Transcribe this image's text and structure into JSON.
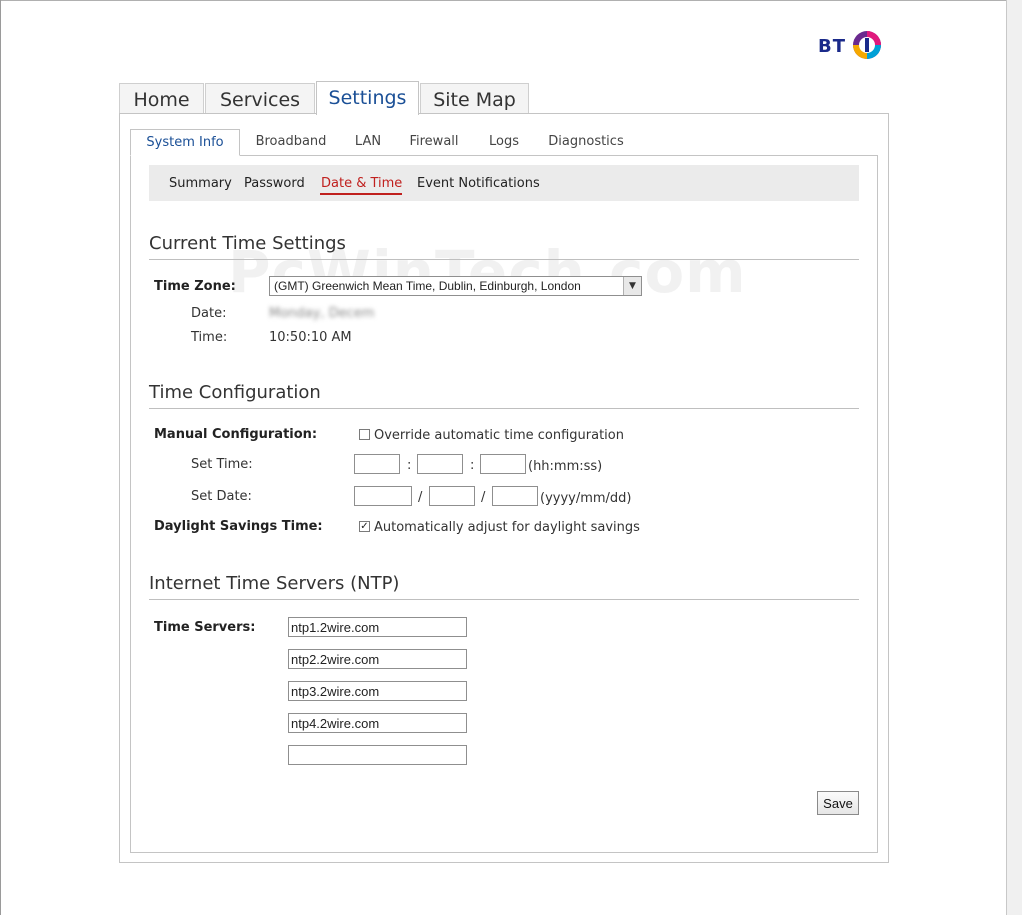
{
  "brand": {
    "logo_text": "BT"
  },
  "main_tabs": [
    {
      "label": "Home"
    },
    {
      "label": "Services"
    },
    {
      "label": "Settings"
    },
    {
      "label": "Site Map"
    }
  ],
  "sub_tabs": [
    {
      "label": "System Info"
    },
    {
      "label": "Broadband"
    },
    {
      "label": "LAN"
    },
    {
      "label": "Firewall"
    },
    {
      "label": "Logs"
    },
    {
      "label": "Diagnostics"
    }
  ],
  "subnav": [
    {
      "label": "Summary"
    },
    {
      "label": "Password"
    },
    {
      "label": "Date & Time"
    },
    {
      "label": "Event Notifications"
    }
  ],
  "watermark": "PcWinTech.com",
  "current_time": {
    "title": "Current Time Settings",
    "timezone_label": "Time Zone:",
    "timezone_value": "(GMT) Greenwich Mean Time, Dublin, Edinburgh, London",
    "date_label": "Date:",
    "date_value": "Monday, Decem",
    "time_label": "Time:",
    "time_value": "10:50:10 AM"
  },
  "time_config": {
    "title": "Time Configuration",
    "manual_label": "Manual Configuration:",
    "override_label": "Override automatic time configuration",
    "override_checked": false,
    "set_time_label": "Set Time:",
    "time_sep": ":",
    "time_hint": "(hh:mm:ss)",
    "set_date_label": "Set Date:",
    "date_sep": "/",
    "date_hint": "(yyyy/mm/dd)",
    "dst_label": "Daylight Savings Time:",
    "dst_option_label": "Automatically adjust for daylight savings",
    "dst_checked": true,
    "check_glyph": "✓"
  },
  "ntp": {
    "title": "Internet Time Servers (NTP)",
    "servers_label": "Time Servers:",
    "servers": [
      "ntp1.2wire.com",
      "ntp2.2wire.com",
      "ntp3.2wire.com",
      "ntp4.2wire.com",
      ""
    ]
  },
  "save_label": "Save",
  "colors": {
    "accent_blue": "#1a4f96",
    "active_red": "#c0201e"
  }
}
